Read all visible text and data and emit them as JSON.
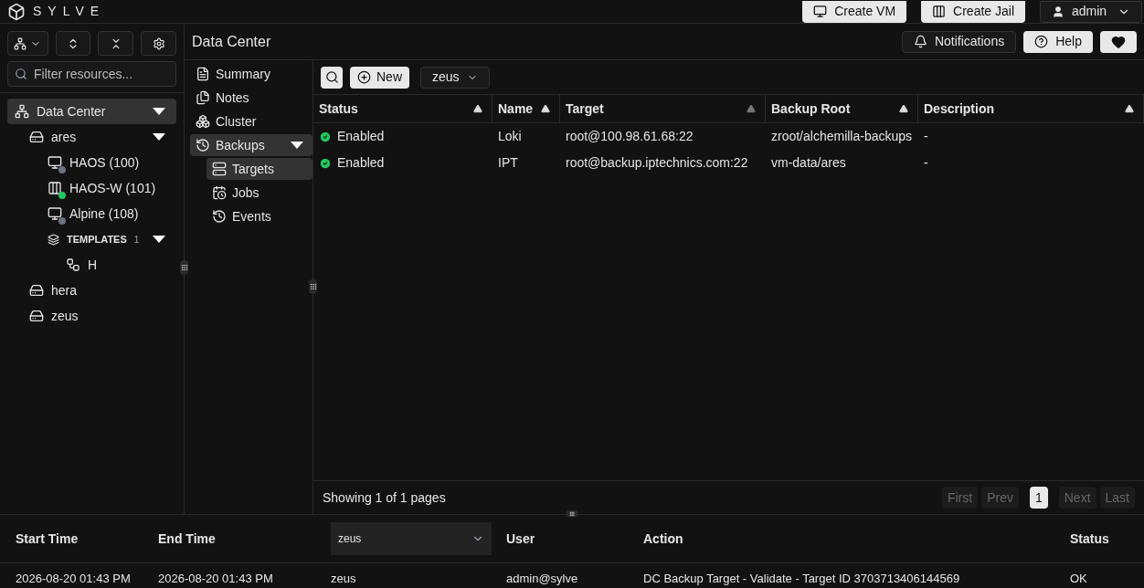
{
  "brand": "SYLVE",
  "top_buttons": [
    {
      "kind": "vm",
      "label": "Create VM"
    },
    {
      "kind": "jail",
      "label": "Create Jail"
    }
  ],
  "user_menu": {
    "label": "admin"
  },
  "sidebar": {
    "filter_placeholder": "Filter resources...",
    "tree": [
      {
        "kind": "datacenter",
        "label": "Data Center",
        "selected": true,
        "expanded": true,
        "children": [
          {
            "kind": "node",
            "label": "ares",
            "selected": false,
            "expanded": true,
            "children": [
              {
                "kind": "vm",
                "label": "HAOS (100)",
                "selected": false,
                "color": "#6b7280"
              },
              {
                "kind": "jail",
                "label": "HAOS-W (101)",
                "selected": false,
                "color": "#22c55e"
              },
              {
                "kind": "vm",
                "label": "Alpine (108)",
                "selected": false,
                "color": "#6b7280"
              },
              {
                "kind": "templates",
                "label": "TEMPLATES",
                "count": "1",
                "selected": false,
                "expanded": true,
                "children": [
                  {
                    "kind": "template",
                    "label": "H",
                    "selected": false
                  }
                ]
              }
            ]
          },
          {
            "kind": "node",
            "label": "hera",
            "selected": false
          },
          {
            "kind": "node",
            "label": "zeus",
            "selected": false
          }
        ]
      }
    ]
  },
  "header": {
    "title": "Data Center",
    "buttons": [
      {
        "kind": "notifications",
        "label": "Notifications"
      },
      {
        "kind": "help",
        "label": "Help"
      },
      {
        "kind": "heart"
      }
    ]
  },
  "nav": [
    {
      "kind": "summary",
      "label": "Summary",
      "selected": false
    },
    {
      "kind": "notes",
      "label": "Notes",
      "selected": false
    },
    {
      "kind": "cluster",
      "label": "Cluster",
      "selected": false
    },
    {
      "kind": "backups",
      "label": "Backups",
      "selected": true,
      "expanded": true,
      "children": [
        {
          "kind": "targets",
          "label": "Targets",
          "selected": true
        },
        {
          "kind": "jobs",
          "label": "Jobs",
          "selected": false
        },
        {
          "kind": "events",
          "label": "Events",
          "selected": false
        }
      ]
    }
  ],
  "toolbar": {
    "new_label": "New",
    "node_select": "zeus"
  },
  "table": {
    "columns": [
      {
        "label": "Status",
        "sorted": true
      },
      {
        "label": "Name",
        "sorted": true
      },
      {
        "label": "Target",
        "sorted": false
      },
      {
        "label": "Backup Root",
        "sorted": true
      },
      {
        "label": "Description",
        "sorted": true
      }
    ],
    "rows": [
      [
        "Enabled",
        "Loki",
        "root@100.98.61.68:22",
        "zroot/alchemilla-backups",
        "-"
      ],
      [
        "Enabled",
        "IPT",
        "root@backup.iptechnics.com:22",
        "vm-data/ares",
        "-"
      ]
    ]
  },
  "pagination": {
    "summary": "Showing 1 of 1 pages",
    "buttons": [
      {
        "label": "First",
        "selected": false
      },
      {
        "label": "Prev",
        "selected": false
      },
      {
        "label": "1",
        "selected": true
      },
      {
        "label": "Next",
        "selected": false
      },
      {
        "label": "Last",
        "selected": false
      }
    ]
  },
  "audit": {
    "columns": [
      {
        "kind": "text",
        "label": "Start Time"
      },
      {
        "kind": "text",
        "label": "End Time"
      },
      {
        "kind": "select",
        "label": "zeus"
      },
      {
        "kind": "text",
        "label": "User"
      },
      {
        "kind": "text",
        "label": "Action"
      },
      {
        "kind": "text",
        "label": "Status"
      }
    ],
    "rows": [
      [
        "2026-08-20 01:43 PM",
        "2026-08-20 01:43 PM",
        "zeus",
        "admin@sylve",
        "DC Backup Target - Validate - Target ID 3703713406144569",
        "OK"
      ]
    ]
  }
}
